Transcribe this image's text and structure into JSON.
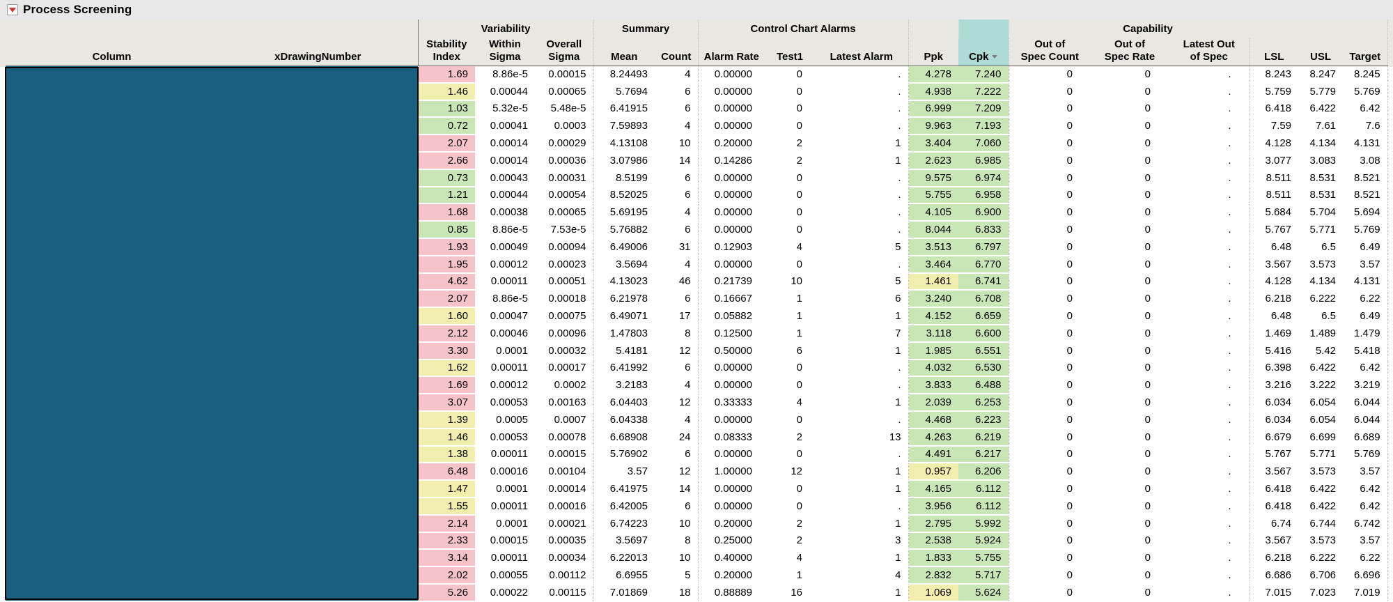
{
  "title": "Process Screening",
  "colors": {
    "title_bg": "#e8e8e8",
    "header_bg": "#e9e7e2",
    "red_cell": "#f5c3c8",
    "yellow_cell": "#f2eeae",
    "green_cell": "#c9e6b6",
    "cpk_header": "#aedbd6",
    "selection": "#17607f",
    "separator": "#bdbdbd"
  },
  "header": {
    "groups": {
      "variability": "Variability",
      "summary": "Summary",
      "alarms": "Control Chart Alarms",
      "capability": "Capability"
    },
    "columns": [
      {
        "label": "Column",
        "name": "column"
      },
      {
        "label": "xDrawingNumber",
        "name": "drawing-number"
      },
      {
        "label": "Stability\nIndex",
        "name": "stability-index"
      },
      {
        "label": "Within\nSigma",
        "name": "within-sigma"
      },
      {
        "label": "Overall\nSigma",
        "name": "overall-sigma"
      },
      {
        "label": "Mean",
        "name": "mean"
      },
      {
        "label": "Count",
        "name": "count"
      },
      {
        "label": "Alarm Rate",
        "name": "alarm-rate"
      },
      {
        "label": "Test1",
        "name": "test1"
      },
      {
        "label": "Latest Alarm",
        "name": "latest-alarm"
      },
      {
        "label": "Ppk",
        "name": "ppk"
      },
      {
        "label": "Cpk",
        "name": "cpk"
      },
      {
        "label": "Out of\nSpec Count",
        "name": "out-of-spec-count"
      },
      {
        "label": "Out of\nSpec Rate",
        "name": "out-of-spec-rate"
      },
      {
        "label": "Latest Out\nof Spec",
        "name": "latest-out-of-spec"
      },
      {
        "label": "LSL",
        "name": "lsl"
      },
      {
        "label": "USL",
        "name": "usl"
      },
      {
        "label": "Target",
        "name": "target"
      }
    ]
  },
  "legend_note": "row cell order: stability_index, stability_color(r/y/g), within_sigma, overall_sigma, mean, count, alarm_rate, test1, latest_alarm, ppk, ppk_color, cpk, out_of_spec_count, out_of_spec_rate, latest_out_of_spec, lsl, usl, target",
  "rows": [
    [
      "1.69",
      "r",
      "8.86e-5",
      "0.00015",
      "8.24493",
      "4",
      "0.00000",
      "0",
      ".",
      "4.278",
      "g",
      "7.240",
      "0",
      "0",
      ".",
      "8.243",
      "8.247",
      "8.245"
    ],
    [
      "1.46",
      "y",
      "0.00044",
      "0.00065",
      "5.7694",
      "6",
      "0.00000",
      "0",
      ".",
      "4.938",
      "g",
      "7.222",
      "0",
      "0",
      ".",
      "5.759",
      "5.779",
      "5.769"
    ],
    [
      "1.03",
      "g",
      "5.32e-5",
      "5.48e-5",
      "6.41915",
      "6",
      "0.00000",
      "0",
      ".",
      "6.999",
      "g",
      "7.209",
      "0",
      "0",
      ".",
      "6.418",
      "6.422",
      "6.42"
    ],
    [
      "0.72",
      "g",
      "0.00041",
      "0.0003",
      "7.59893",
      "4",
      "0.00000",
      "0",
      ".",
      "9.963",
      "g",
      "7.193",
      "0",
      "0",
      ".",
      "7.59",
      "7.61",
      "7.6"
    ],
    [
      "2.07",
      "r",
      "0.00014",
      "0.00029",
      "4.13108",
      "10",
      "0.20000",
      "2",
      "1",
      "3.404",
      "g",
      "7.060",
      "0",
      "0",
      ".",
      "4.128",
      "4.134",
      "4.131"
    ],
    [
      "2.66",
      "r",
      "0.00014",
      "0.00036",
      "3.07986",
      "14",
      "0.14286",
      "2",
      "1",
      "2.623",
      "g",
      "6.985",
      "0",
      "0",
      ".",
      "3.077",
      "3.083",
      "3.08"
    ],
    [
      "0.73",
      "g",
      "0.00043",
      "0.00031",
      "8.5199",
      "6",
      "0.00000",
      "0",
      ".",
      "9.575",
      "g",
      "6.974",
      "0",
      "0",
      ".",
      "8.511",
      "8.531",
      "8.521"
    ],
    [
      "1.21",
      "g",
      "0.00044",
      "0.00054",
      "8.52025",
      "6",
      "0.00000",
      "0",
      ".",
      "5.755",
      "g",
      "6.958",
      "0",
      "0",
      ".",
      "8.511",
      "8.531",
      "8.521"
    ],
    [
      "1.68",
      "r",
      "0.00038",
      "0.00065",
      "5.69195",
      "4",
      "0.00000",
      "0",
      ".",
      "4.105",
      "g",
      "6.900",
      "0",
      "0",
      ".",
      "5.684",
      "5.704",
      "5.694"
    ],
    [
      "0.85",
      "g",
      "8.86e-5",
      "7.53e-5",
      "5.76882",
      "6",
      "0.00000",
      "0",
      ".",
      "8.044",
      "g",
      "6.833",
      "0",
      "0",
      ".",
      "5.767",
      "5.771",
      "5.769"
    ],
    [
      "1.93",
      "r",
      "0.00049",
      "0.00094",
      "6.49006",
      "31",
      "0.12903",
      "4",
      "5",
      "3.513",
      "g",
      "6.797",
      "0",
      "0",
      ".",
      "6.48",
      "6.5",
      "6.49"
    ],
    [
      "1.95",
      "r",
      "0.00012",
      "0.00023",
      "3.5694",
      "4",
      "0.00000",
      "0",
      ".",
      "3.464",
      "g",
      "6.770",
      "0",
      "0",
      ".",
      "3.567",
      "3.573",
      "3.57"
    ],
    [
      "4.62",
      "r",
      "0.00011",
      "0.00051",
      "4.13023",
      "46",
      "0.21739",
      "10",
      "5",
      "1.461",
      "y",
      "6.741",
      "0",
      "0",
      ".",
      "4.128",
      "4.134",
      "4.131"
    ],
    [
      "2.07",
      "r",
      "8.86e-5",
      "0.00018",
      "6.21978",
      "6",
      "0.16667",
      "1",
      "6",
      "3.240",
      "g",
      "6.708",
      "0",
      "0",
      ".",
      "6.218",
      "6.222",
      "6.22"
    ],
    [
      "1.60",
      "y",
      "0.00047",
      "0.00075",
      "6.49071",
      "17",
      "0.05882",
      "1",
      "1",
      "4.152",
      "g",
      "6.659",
      "0",
      "0",
      ".",
      "6.48",
      "6.5",
      "6.49"
    ],
    [
      "2.12",
      "r",
      "0.00046",
      "0.00096",
      "1.47803",
      "8",
      "0.12500",
      "1",
      "7",
      "3.118",
      "g",
      "6.600",
      "0",
      "0",
      ".",
      "1.469",
      "1.489",
      "1.479"
    ],
    [
      "3.30",
      "r",
      "0.0001",
      "0.00032",
      "5.4181",
      "12",
      "0.50000",
      "6",
      "1",
      "1.985",
      "g",
      "6.551",
      "0",
      "0",
      ".",
      "5.416",
      "5.42",
      "5.418"
    ],
    [
      "1.62",
      "y",
      "0.00011",
      "0.00017",
      "6.41992",
      "6",
      "0.00000",
      "0",
      ".",
      "4.032",
      "g",
      "6.530",
      "0",
      "0",
      ".",
      "6.398",
      "6.422",
      "6.42"
    ],
    [
      "1.69",
      "r",
      "0.00012",
      "0.0002",
      "3.2183",
      "4",
      "0.00000",
      "0",
      ".",
      "3.833",
      "g",
      "6.488",
      "0",
      "0",
      ".",
      "3.216",
      "3.222",
      "3.219"
    ],
    [
      "3.07",
      "r",
      "0.00053",
      "0.00163",
      "6.04403",
      "12",
      "0.33333",
      "4",
      "1",
      "2.039",
      "g",
      "6.253",
      "0",
      "0",
      ".",
      "6.034",
      "6.054",
      "6.044"
    ],
    [
      "1.39",
      "y",
      "0.0005",
      "0.0007",
      "6.04338",
      "4",
      "0.00000",
      "0",
      ".",
      "4.468",
      "g",
      "6.223",
      "0",
      "0",
      ".",
      "6.034",
      "6.054",
      "6.044"
    ],
    [
      "1.46",
      "y",
      "0.00053",
      "0.00078",
      "6.68908",
      "24",
      "0.08333",
      "2",
      "13",
      "4.263",
      "g",
      "6.219",
      "0",
      "0",
      ".",
      "6.679",
      "6.699",
      "6.689"
    ],
    [
      "1.38",
      "y",
      "0.00011",
      "0.00015",
      "5.76902",
      "6",
      "0.00000",
      "0",
      ".",
      "4.491",
      "g",
      "6.217",
      "0",
      "0",
      ".",
      "5.767",
      "5.771",
      "5.769"
    ],
    [
      "6.48",
      "r",
      "0.00016",
      "0.00104",
      "3.57",
      "12",
      "1.00000",
      "12",
      "1",
      "0.957",
      "y",
      "6.206",
      "0",
      "0",
      ".",
      "3.567",
      "3.573",
      "3.57"
    ],
    [
      "1.47",
      "y",
      "0.0001",
      "0.00014",
      "6.41975",
      "14",
      "0.00000",
      "0",
      "1",
      "4.165",
      "g",
      "6.112",
      "0",
      "0",
      ".",
      "6.418",
      "6.422",
      "6.42"
    ],
    [
      "1.55",
      "y",
      "0.00011",
      "0.00016",
      "6.42005",
      "6",
      "0.00000",
      "0",
      ".",
      "3.956",
      "g",
      "6.112",
      "0",
      "0",
      ".",
      "6.418",
      "6.422",
      "6.42"
    ],
    [
      "2.14",
      "r",
      "0.0001",
      "0.00021",
      "6.74223",
      "10",
      "0.20000",
      "2",
      "1",
      "2.795",
      "g",
      "5.992",
      "0",
      "0",
      ".",
      "6.74",
      "6.744",
      "6.742"
    ],
    [
      "2.33",
      "r",
      "0.00015",
      "0.00035",
      "3.5697",
      "8",
      "0.25000",
      "2",
      "3",
      "2.538",
      "g",
      "5.924",
      "0",
      "0",
      ".",
      "3.567",
      "3.573",
      "3.57"
    ],
    [
      "3.14",
      "r",
      "0.00011",
      "0.00034",
      "6.22013",
      "10",
      "0.40000",
      "4",
      "1",
      "1.833",
      "g",
      "5.755",
      "0",
      "0",
      ".",
      "6.218",
      "6.222",
      "6.22"
    ],
    [
      "2.02",
      "r",
      "0.00055",
      "0.00112",
      "6.6955",
      "5",
      "0.20000",
      "1",
      "4",
      "2.832",
      "g",
      "5.717",
      "0",
      "0",
      ".",
      "6.686",
      "6.706",
      "6.696"
    ],
    [
      "5.26",
      "r",
      "0.00022",
      "0.00115",
      "7.01869",
      "18",
      "0.88889",
      "16",
      "1",
      "1.069",
      "y",
      "5.624",
      "0",
      "0",
      ".",
      "7.015",
      "7.023",
      "7.019"
    ]
  ]
}
